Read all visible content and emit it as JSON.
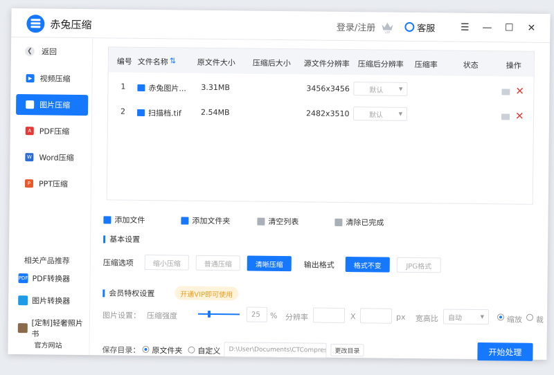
{
  "app": {
    "title": "赤兔压缩",
    "login": "登录/注册",
    "service": "客服"
  },
  "sidebar": {
    "back": "返回",
    "items": [
      {
        "label": "视频压缩",
        "color": "#1677ff"
      },
      {
        "label": "图片压缩",
        "color": "#1677ff"
      },
      {
        "label": "PDF压缩",
        "color": "#e53935"
      },
      {
        "label": "Word压缩",
        "color": "#2b6cd4"
      },
      {
        "label": "PPT压缩",
        "color": "#e8582a"
      }
    ],
    "related_title": "相关产品推荐",
    "related": [
      {
        "label": "PDF转换器",
        "icon_text": "PDF",
        "color": "#1677ff"
      },
      {
        "label": "图片转换器",
        "icon_text": "",
        "color": "#1e9be8"
      },
      {
        "label": "[定制]轻奢照片书",
        "icon_text": "",
        "color": "#8a6a4a"
      }
    ],
    "website": "官方网站"
  },
  "table": {
    "headers": [
      "编号",
      "文件名称",
      "原文件大小",
      "压缩后大小",
      "源文件分辨率",
      "压缩后分辨率",
      "压缩率",
      "状态",
      "操作"
    ],
    "rows": [
      {
        "no": "1",
        "name": "赤兔图片...",
        "size": "3.31MB",
        "resolution": "3456x3456",
        "select": "默认"
      },
      {
        "no": "2",
        "name": "扫描档.tif",
        "size": "2.54MB",
        "resolution": "2482x3510",
        "select": "默认"
      }
    ]
  },
  "toolbar": {
    "add_file": "添加文件",
    "add_folder": "添加文件夹",
    "clear_list": "清空列表",
    "clear_done": "清除已完成"
  },
  "basic": {
    "title": "基本设置",
    "compress_label": "压缩选项",
    "options": [
      "缩小压缩",
      "普通压缩",
      "清晰压缩"
    ],
    "format_label": "输出格式",
    "formats": [
      "格式不变",
      "JPG格式"
    ]
  },
  "vip": {
    "title": "会员特权设置",
    "tag": "开通VIP即可使用",
    "image_settings": "图片设置：",
    "strength": "压缩强度",
    "strength_value": "25",
    "percent": "%",
    "resolution": "分辨率",
    "x": "X",
    "px": "px",
    "aspect": "宽高比",
    "aspect_value": "自动",
    "scale": "缩放",
    "crop": "裁"
  },
  "save": {
    "label": "保存目录：",
    "original": "原文件夹",
    "custom": "自定义",
    "path": "D:\\User\\Documents\\CTCompres",
    "change": "更改目录",
    "start": "开始处理"
  }
}
